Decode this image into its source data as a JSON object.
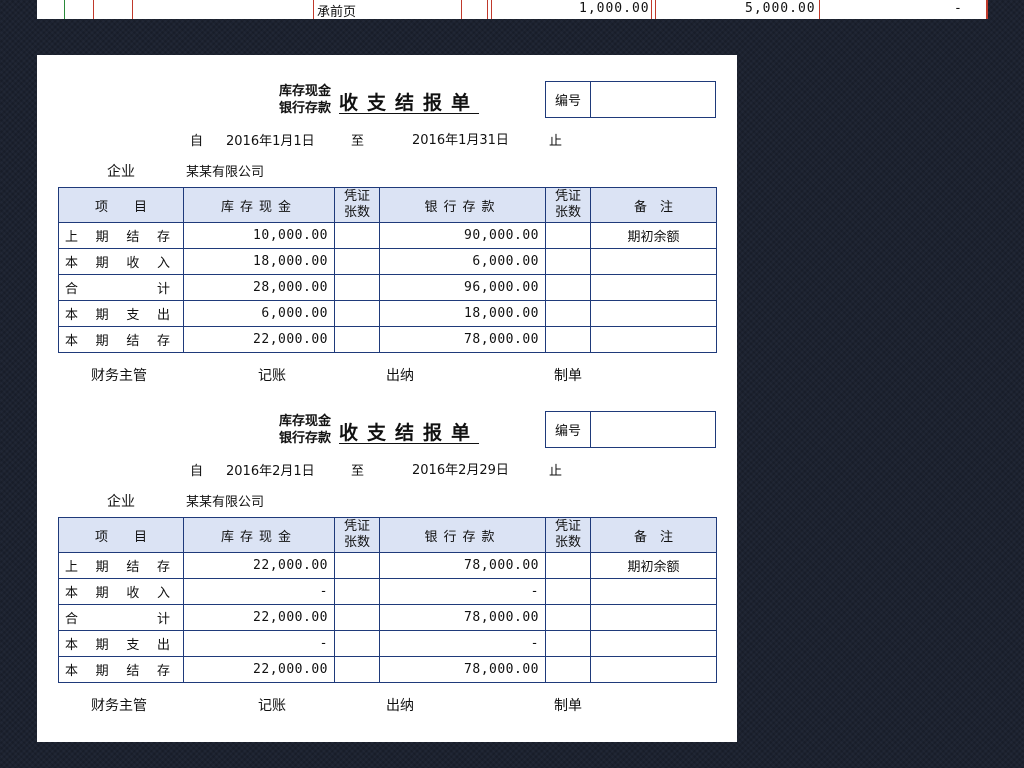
{
  "top_strip": {
    "label": "承前页",
    "amount1": "1,000.00",
    "amount2": "5,000.00",
    "amount3": "-"
  },
  "headers": {
    "item": "项　　目",
    "cash": "库存现金",
    "voucher1": "凭证",
    "voucher2": "张数",
    "bank": "银行存款",
    "note": "备　注"
  },
  "labels": {
    "title_sub1": "库存现金",
    "title_sub2": "银行存款",
    "title_main": "收支结报单",
    "number": "编号",
    "from": "自",
    "to": "至",
    "end": "止",
    "company_label": "企业",
    "company": "某某有限公司",
    "finance_head": "财务主管",
    "bookkeeper": "记账",
    "cashier": "出纳",
    "preparer": "制单"
  },
  "reports": [
    {
      "date_from": "2016年1月1日",
      "date_to": "2016年1月31日",
      "rows": [
        {
          "item": "上期结存",
          "cash": "10,000.00",
          "v1": "",
          "bank": "90,000.00",
          "v2": "",
          "note": "期初余额"
        },
        {
          "item": "本期收入",
          "cash": "18,000.00",
          "v1": "",
          "bank": "6,000.00",
          "v2": "",
          "note": ""
        },
        {
          "item": "合计",
          "cash": "28,000.00",
          "v1": "",
          "bank": "96,000.00",
          "v2": "",
          "note": ""
        },
        {
          "item": "本期支出",
          "cash": "6,000.00",
          "v1": "",
          "bank": "18,000.00",
          "v2": "",
          "note": ""
        },
        {
          "item": "本期结存",
          "cash": "22,000.00",
          "v1": "",
          "bank": "78,000.00",
          "v2": "",
          "note": ""
        }
      ]
    },
    {
      "date_from": "2016年2月1日",
      "date_to": "2016年2月29日",
      "rows": [
        {
          "item": "上期结存",
          "cash": "22,000.00",
          "v1": "",
          "bank": "78,000.00",
          "v2": "",
          "note": "期初余额"
        },
        {
          "item": "本期收入",
          "cash": "-",
          "v1": "",
          "bank": "-",
          "v2": "",
          "note": ""
        },
        {
          "item": "合计",
          "cash": "22,000.00",
          "v1": "",
          "bank": "78,000.00",
          "v2": "",
          "note": ""
        },
        {
          "item": "本期支出",
          "cash": "-",
          "v1": "",
          "bank": "-",
          "v2": "",
          "note": ""
        },
        {
          "item": "本期结存",
          "cash": "22,000.00",
          "v1": "",
          "bank": "78,000.00",
          "v2": "",
          "note": ""
        }
      ]
    }
  ]
}
